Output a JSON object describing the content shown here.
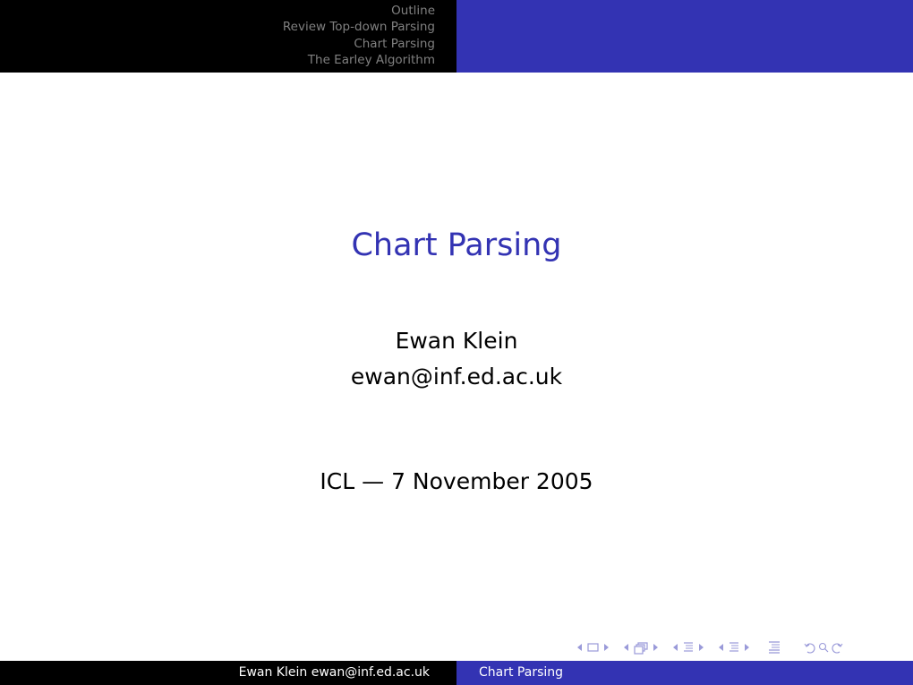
{
  "header": {
    "sections": [
      {
        "label": "Outline"
      },
      {
        "label": "Review Top-down Parsing"
      },
      {
        "label": "Chart Parsing"
      },
      {
        "label": "The Earley Algorithm"
      }
    ]
  },
  "slide": {
    "title": "Chart Parsing",
    "author": "Ewan Klein",
    "email": "ewan@inf.ed.ac.uk",
    "event_date": "ICL — 7 November 2005"
  },
  "navigation": {
    "controls": [
      {
        "icon": "frame-icon",
        "label": "previous/next frame"
      },
      {
        "icon": "slide-icon",
        "label": "previous/next slide"
      },
      {
        "icon": "subsection-icon",
        "label": "previous/next subsection"
      },
      {
        "icon": "section-icon",
        "label": "previous/next section"
      },
      {
        "icon": "document-icon",
        "label": "document"
      },
      {
        "icon": "undo-search-redo-icon",
        "label": "back / search / forward"
      }
    ]
  },
  "footer": {
    "author": "Ewan Klein ewan@inf.ed.ac.uk",
    "title": "Chart Parsing"
  },
  "colors": {
    "accent": "#3333b3",
    "header_dark": "#000000",
    "nav_text": "#808080",
    "nav_symbols": "#9a9ad9"
  }
}
